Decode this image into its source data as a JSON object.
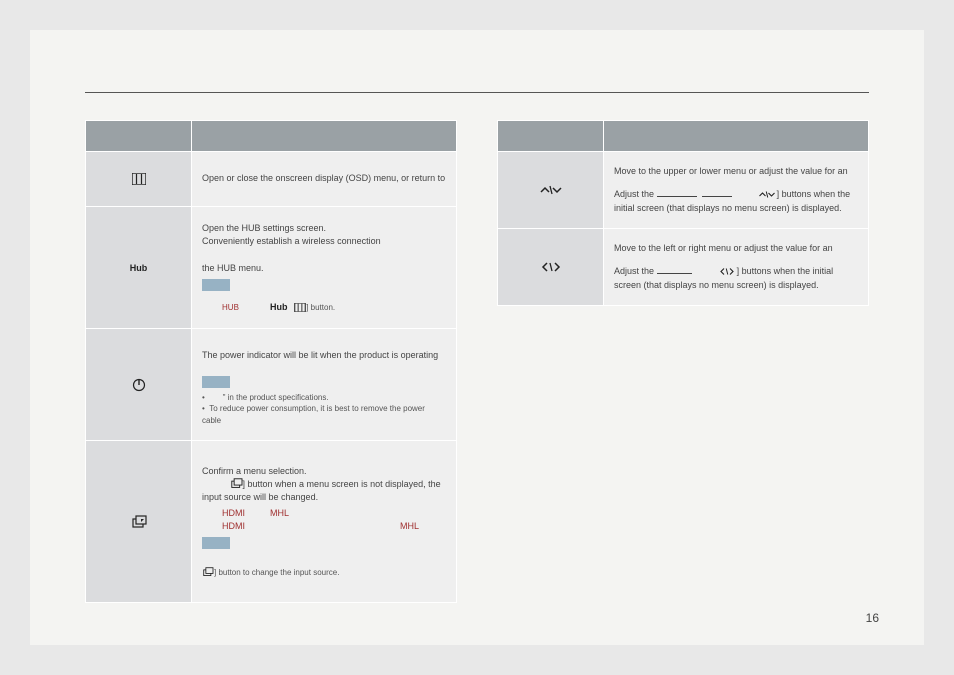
{
  "page_number": "16",
  "left": {
    "r1": "Open or close the onscreen display (OSD) menu, or return to",
    "r2a": "Open the HUB settings screen.",
    "r2b": "Conveniently establish a wireless connection",
    "r2c": "the HUB menu.",
    "r2_hub": "HUB",
    "r2_hubicon": "Hub",
    "r2_button": "] button.",
    "r3a": "The power indicator will be lit when the product is operating",
    "r3b": "\" in the product specifications.",
    "r3c": "To reduce power consumption, it is best to remove the power cable",
    "r4a": "Confirm a menu selection.",
    "r4b": "] button when a menu screen is not displayed, the input source will be changed.",
    "r4_hdmi": "HDMI",
    "r4_mhl": "MHL",
    "r4_note": "] button to change the input source."
  },
  "right": {
    "r1a": "Move to the upper or lower menu or adjust the value for an",
    "r1b": "Adjust the",
    "r1c": "] buttons when the initial screen (that displays no menu screen) is displayed.",
    "r2a": "Move to the left or right menu or adjust the value for an",
    "r2b": "Adjust the",
    "r2c": "] buttons when the initial screen (that displays no menu screen) is displayed."
  }
}
